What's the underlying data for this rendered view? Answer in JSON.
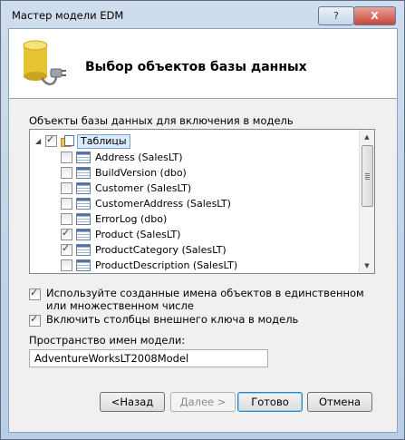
{
  "window": {
    "title": "Мастер модели EDM",
    "help_label": "?",
    "close_label": "X"
  },
  "header": {
    "title": "Выбор объектов базы данных"
  },
  "db_objects": {
    "label": "Объекты базы данных для включения в модель",
    "root": {
      "label": "Таблицы",
      "checked": true,
      "expanded": true
    },
    "items": [
      {
        "label": "Address (SalesLT)",
        "checked": false
      },
      {
        "label": "BuildVersion (dbo)",
        "checked": false
      },
      {
        "label": "Customer (SalesLT)",
        "checked": false
      },
      {
        "label": "CustomerAddress (SalesLT)",
        "checked": false
      },
      {
        "label": "ErrorLog (dbo)",
        "checked": false
      },
      {
        "label": "Product (SalesLT)",
        "checked": true
      },
      {
        "label": "ProductCategory (SalesLT)",
        "checked": true
      },
      {
        "label": "ProductDescription (SalesLT)",
        "checked": false
      }
    ]
  },
  "options": {
    "singularize_label": "Используйте созданные имена объектов в единственном или множественном числе",
    "singularize_checked": true,
    "fk_label": "Включить столбцы внешнего ключа в модель",
    "fk_checked": true
  },
  "namespace": {
    "label": "Пространство имен модели:",
    "value": "AdventureWorksLT2008Model"
  },
  "buttons": {
    "back": "<Назад",
    "next": "Далее >",
    "finish": "Готово",
    "cancel": "Отмена"
  }
}
